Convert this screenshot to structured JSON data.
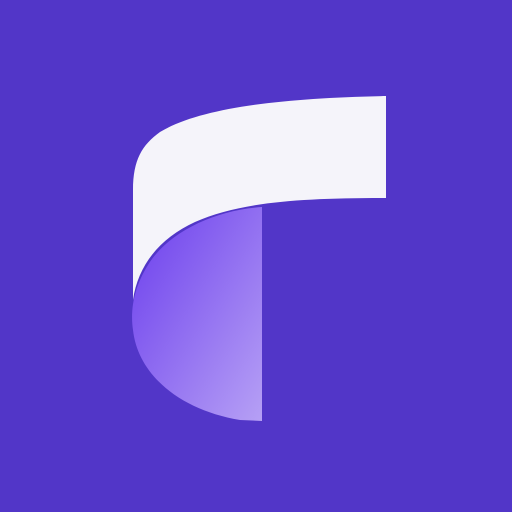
{
  "app_icon": {
    "icon_name": "stylized-letter-t-logo",
    "colors": {
      "background": "#5236c8",
      "ribbon_top": "#f5f4fa",
      "ribbon_gradient_start": "#6b3ded",
      "ribbon_gradient_end": "#b6a0f5"
    }
  }
}
